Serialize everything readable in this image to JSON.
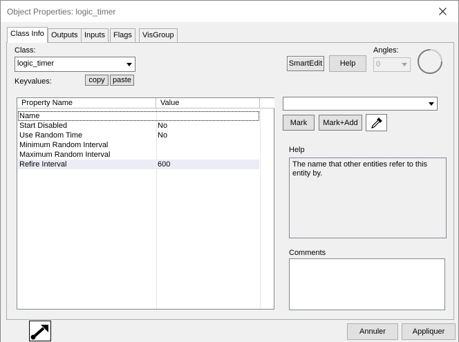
{
  "window": {
    "title": "Object Properties: logic_timer"
  },
  "tabs": [
    {
      "label": "Class Info",
      "active": true
    },
    {
      "label": "Outputs"
    },
    {
      "label": "Inputs"
    },
    {
      "label": "Flags"
    },
    {
      "label": "VisGroup"
    }
  ],
  "class_section": {
    "class_label": "Class:",
    "class_value": "logic_timer",
    "keyvalues_label": "Keyvalues:",
    "copy_label": "copy",
    "paste_label": "paste"
  },
  "toolbar": {
    "smartedit_label": "SmartEdit",
    "help_label": "Help",
    "angles_label": "Angles:",
    "angles_value": "0"
  },
  "property_table": {
    "columns": [
      "Property Name",
      "Value"
    ],
    "rows": [
      {
        "name": "Name",
        "value": ""
      },
      {
        "name": "Start Disabled",
        "value": "No"
      },
      {
        "name": "Use Random Time",
        "value": "No"
      },
      {
        "name": "Minimum Random Interval",
        "value": ""
      },
      {
        "name": "Maximum Random Interval",
        "value": ""
      },
      {
        "name": "Refire Interval",
        "value": "600"
      }
    ]
  },
  "right_panel": {
    "value_combo": "",
    "mark_label": "Mark",
    "mark_add_label": "Mark+Add",
    "help_title": "Help",
    "help_text": "The name that other entities refer to this entity by.",
    "comments_title": "Comments",
    "comments_text": ""
  },
  "footer": {
    "cancel_label": "Annuler",
    "apply_label": "Appliquer"
  },
  "icons": {
    "close": "close-icon",
    "dropdown": "chevron-down-icon",
    "eyedropper": "eyedropper-icon",
    "pin": "pin-icon",
    "angle_dial": "angle-dial-icon"
  }
}
